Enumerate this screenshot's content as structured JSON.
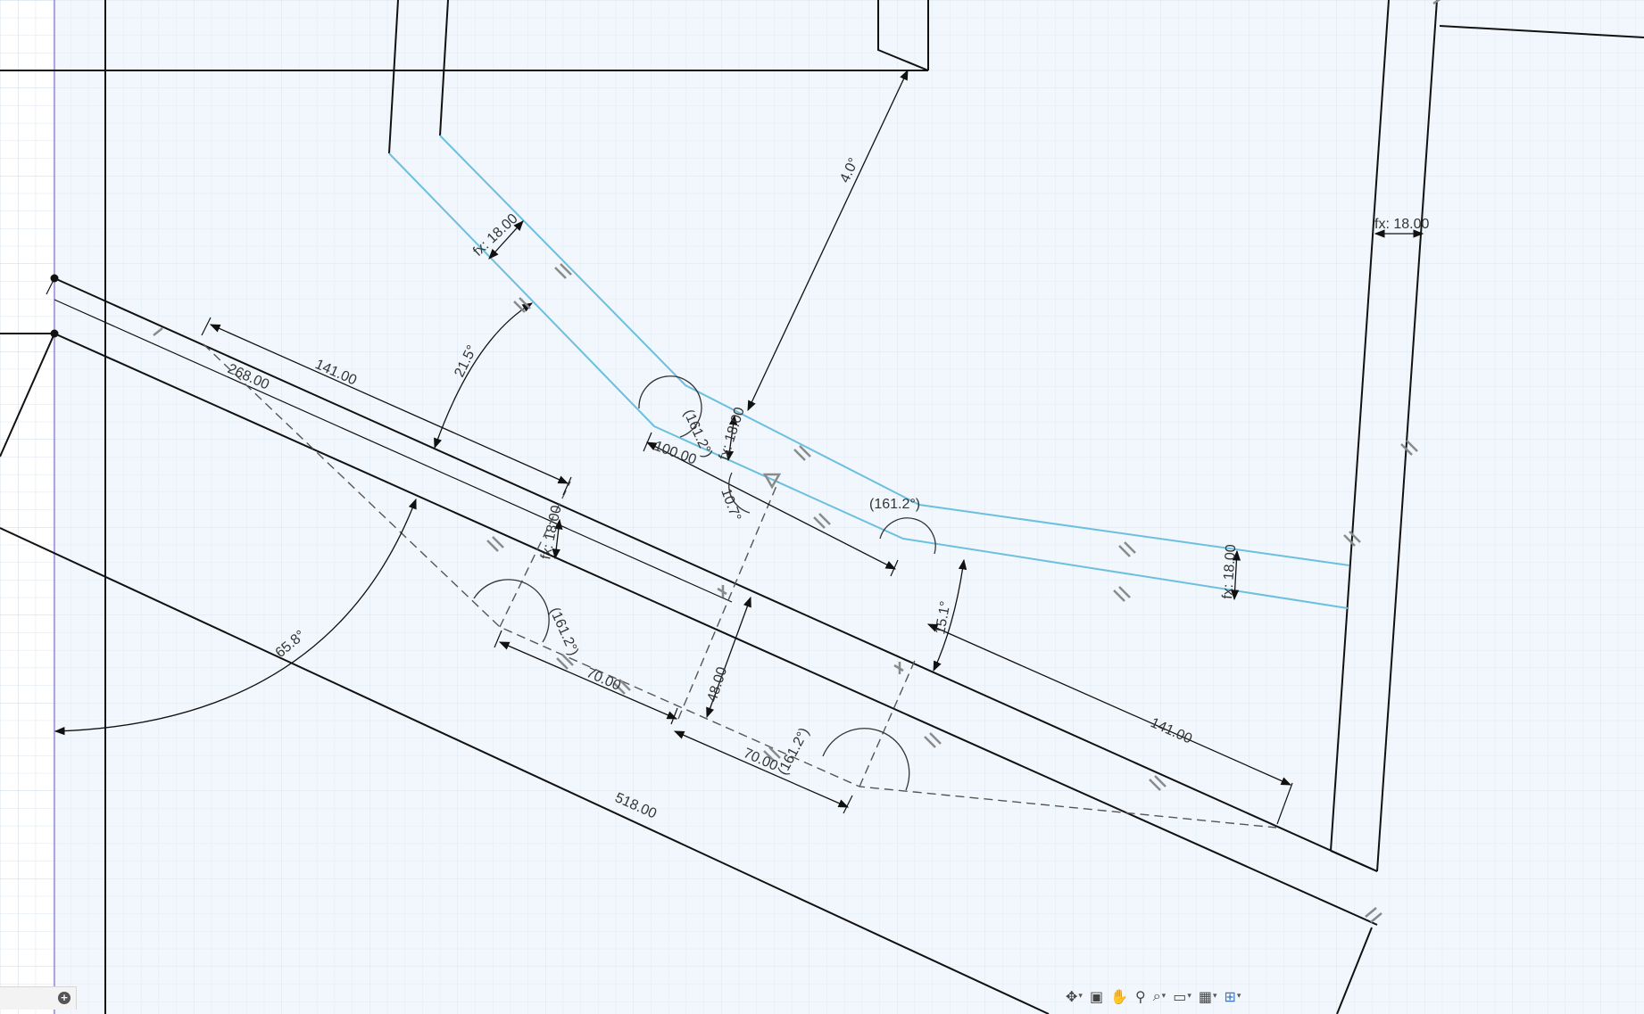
{
  "sketch": {
    "dimensions": {
      "fx_top_left": "fx: 18.00",
      "fx_top_right": "fx: 18.00",
      "fx_mid": "fx: 18.00",
      "fx_right": "fx: 18.00",
      "fx_lower": "fx: 18.00",
      "d_141_top": "141.00",
      "d_141_bottom": "141.00",
      "d_268": "268.00",
      "d_100": "100.00",
      "d_70_a": "70.00",
      "d_70_b": "70.00",
      "d_48": "48.00",
      "d_518": "518.00"
    },
    "angles": {
      "a_40": "4.0°",
      "a_21_5": "21.5°",
      "a_65_8": "65.8°",
      "a_161_a": "(161.2°)",
      "a_161_b": "(161.2°)",
      "a_161_c": "(161.2°)",
      "a_161_d": "(161.2°)",
      "a_10_7": "10.7°",
      "a_15_1": "15.1°"
    }
  },
  "colors": {
    "background": "#ffffff",
    "canvas_fill": "#eef6fc",
    "grid": "#d7e4ee",
    "line": "#111111",
    "selected": "#6cbfde",
    "axis": "#9a87d6"
  },
  "toolbar": {
    "icons": [
      "orbit-icon",
      "look-at-icon",
      "pan-icon",
      "zoom-icon",
      "fit-icon",
      "display-settings-icon",
      "grid-settings-icon",
      "viewports-icon"
    ]
  }
}
